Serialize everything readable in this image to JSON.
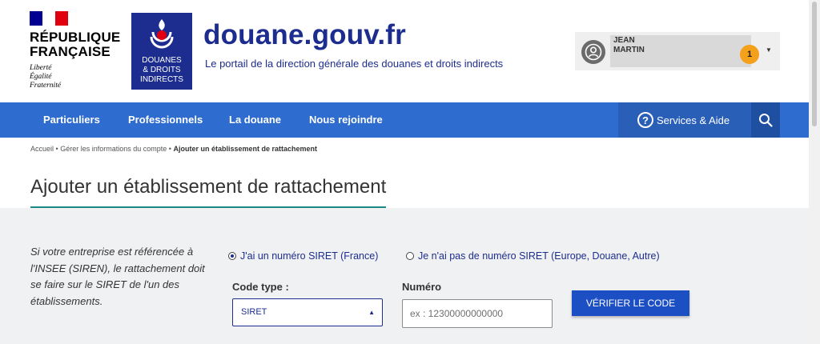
{
  "header": {
    "republic_title_line1": "RÉPUBLIQUE",
    "republic_title_line2": "FRANÇAISE",
    "motto_line1": "Liberté",
    "motto_line2": "Égalité",
    "motto_line3": "Fraternité",
    "dd_logo_line1": "DOUANES",
    "dd_logo_line2": "& DROITS",
    "dd_logo_line3": "INDIRECTS",
    "site_title": "douane.gouv.fr",
    "site_subtitle": "Le portail de la direction générale des douanes et droits indirects"
  },
  "user": {
    "first_name": "JEAN",
    "last_name": "MARTIN",
    "notification_count": "1",
    "avatar_icon": "user-circle-icon",
    "dropdown_icon": "caret-down-icon"
  },
  "nav": {
    "items": [
      {
        "label": "Particuliers"
      },
      {
        "label": "Professionnels"
      },
      {
        "label": "La douane"
      },
      {
        "label": "Nous rejoindre"
      }
    ],
    "services_label": "Services & Aide",
    "services_icon": "question-circle-icon",
    "search_icon": "search-icon"
  },
  "breadcrumb": {
    "item1": "Accueil",
    "item2": "Gérer les informations du compte",
    "current": "Ajouter un établissement de rattachement",
    "separator": "•"
  },
  "page": {
    "title": "Ajouter un établissement de rattachement"
  },
  "form": {
    "info_text": "Si votre entreprise est référencée à l'INSEE (SIREN), le rattachement doit se faire sur le SIRET de l'un des établissements.",
    "radio_siret_label": "J'ai un numéro SIRET (France)",
    "radio_no_siret_label": "Je n'ai pas de numéro SIRET (Europe, Douane, Autre)",
    "radio_selected": "siret",
    "code_type_label": "Code type :",
    "code_type_value": "SIRET",
    "numero_label": "Numéro",
    "numero_placeholder": "ex : 12300000000000",
    "verify_button": "VÉRIFIER LE CODE"
  },
  "colors": {
    "brand_blue": "#1d2d8f",
    "nav_blue": "#2f6ccf",
    "accent_teal": "#1c8a84",
    "badge_orange": "#f5a01a",
    "button_blue": "#1d4fc4",
    "panel_gray": "#f0f1f2"
  }
}
